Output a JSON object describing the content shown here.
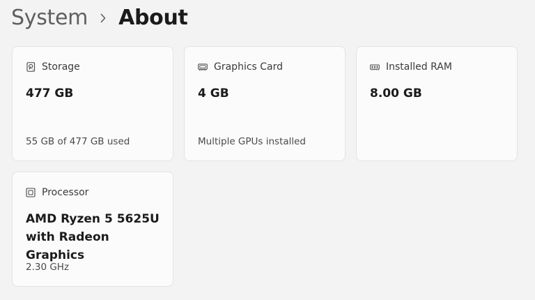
{
  "breadcrumb": {
    "parent": "System",
    "current": "About"
  },
  "cards": {
    "storage": {
      "icon": "storage-icon",
      "label": "Storage",
      "value": "477 GB",
      "detail": "55 GB of 477 GB used"
    },
    "graphics": {
      "icon": "graphics-card-icon",
      "label": "Graphics Card",
      "value": "4 GB",
      "detail": "Multiple GPUs installed"
    },
    "ram": {
      "icon": "ram-icon",
      "label": "Installed RAM",
      "value": "8.00 GB",
      "detail": ""
    },
    "processor": {
      "icon": "processor-icon",
      "label": "Processor",
      "value_line1": "AMD Ryzen 5 5625U",
      "value_line2": "with Radeon Graphics",
      "detail": "2.30 GHz"
    }
  }
}
